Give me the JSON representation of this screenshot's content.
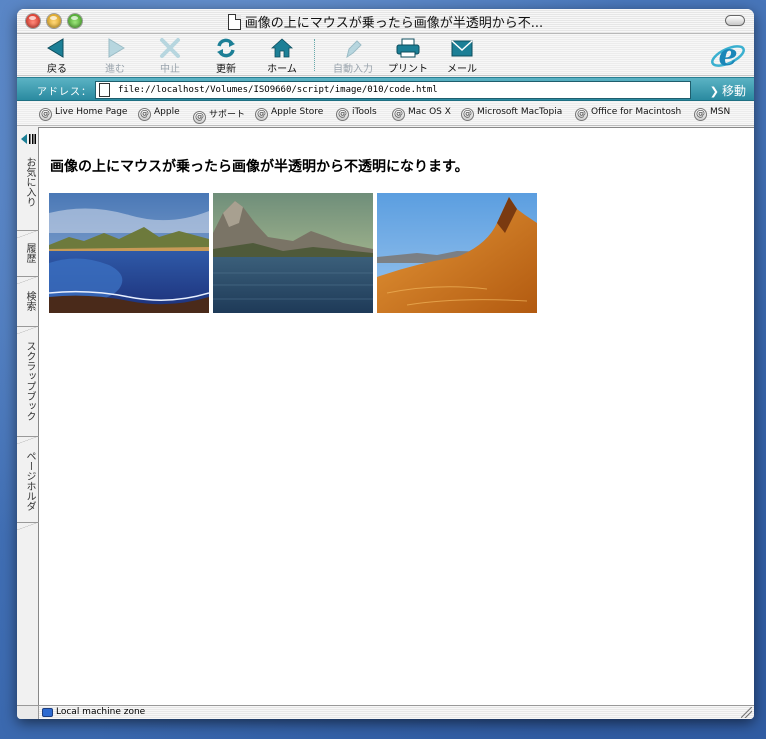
{
  "window": {
    "title": "画像の上にマウスが乗ったら画像が半透明から不..."
  },
  "toolbar": {
    "buttons": [
      {
        "id": "back",
        "label": "戻る",
        "icon": "back-arrow-icon",
        "enabled": true
      },
      {
        "id": "forward",
        "label": "進む",
        "icon": "forward-arrow-icon",
        "enabled": false
      },
      {
        "id": "stop",
        "label": "中止",
        "icon": "stop-x-icon",
        "enabled": false
      },
      {
        "id": "refresh",
        "label": "更新",
        "icon": "refresh-icon",
        "enabled": true
      },
      {
        "id": "home",
        "label": "ホーム",
        "icon": "home-icon",
        "enabled": true
      },
      {
        "id": "autofill",
        "label": "自動入力",
        "icon": "autofill-icon",
        "enabled": false
      },
      {
        "id": "print",
        "label": "プリント",
        "icon": "printer-icon",
        "enabled": true
      },
      {
        "id": "mail",
        "label": "メール",
        "icon": "mail-icon",
        "enabled": true
      }
    ]
  },
  "address": {
    "label": "アドレス：",
    "url": "file://localhost/Volumes/ISO9660/script/image/010/code.html",
    "go_label": "移動"
  },
  "favorites": [
    "Live Home Page",
    "Apple",
    "サポート",
    "Apple Store",
    "iTools",
    "Mac OS X",
    "Microsoft MacTopia",
    "Office for Macintosh",
    "MSN"
  ],
  "sidebar": {
    "tabs": [
      "お気に入り",
      "履歴",
      "検索",
      "スクラップブック",
      "ページホルダ"
    ]
  },
  "page": {
    "heading": "画像の上にマウスが乗ったら画像が半透明から不透明になります。",
    "images": [
      "coastal-bay-landscape",
      "mountain-lake-landscape",
      "desert-dune-landscape"
    ]
  },
  "status": {
    "zone": "Local machine zone"
  },
  "colors": {
    "accent_teal": "#2a8aa0",
    "desktop_blue": "#3d6bb0"
  }
}
